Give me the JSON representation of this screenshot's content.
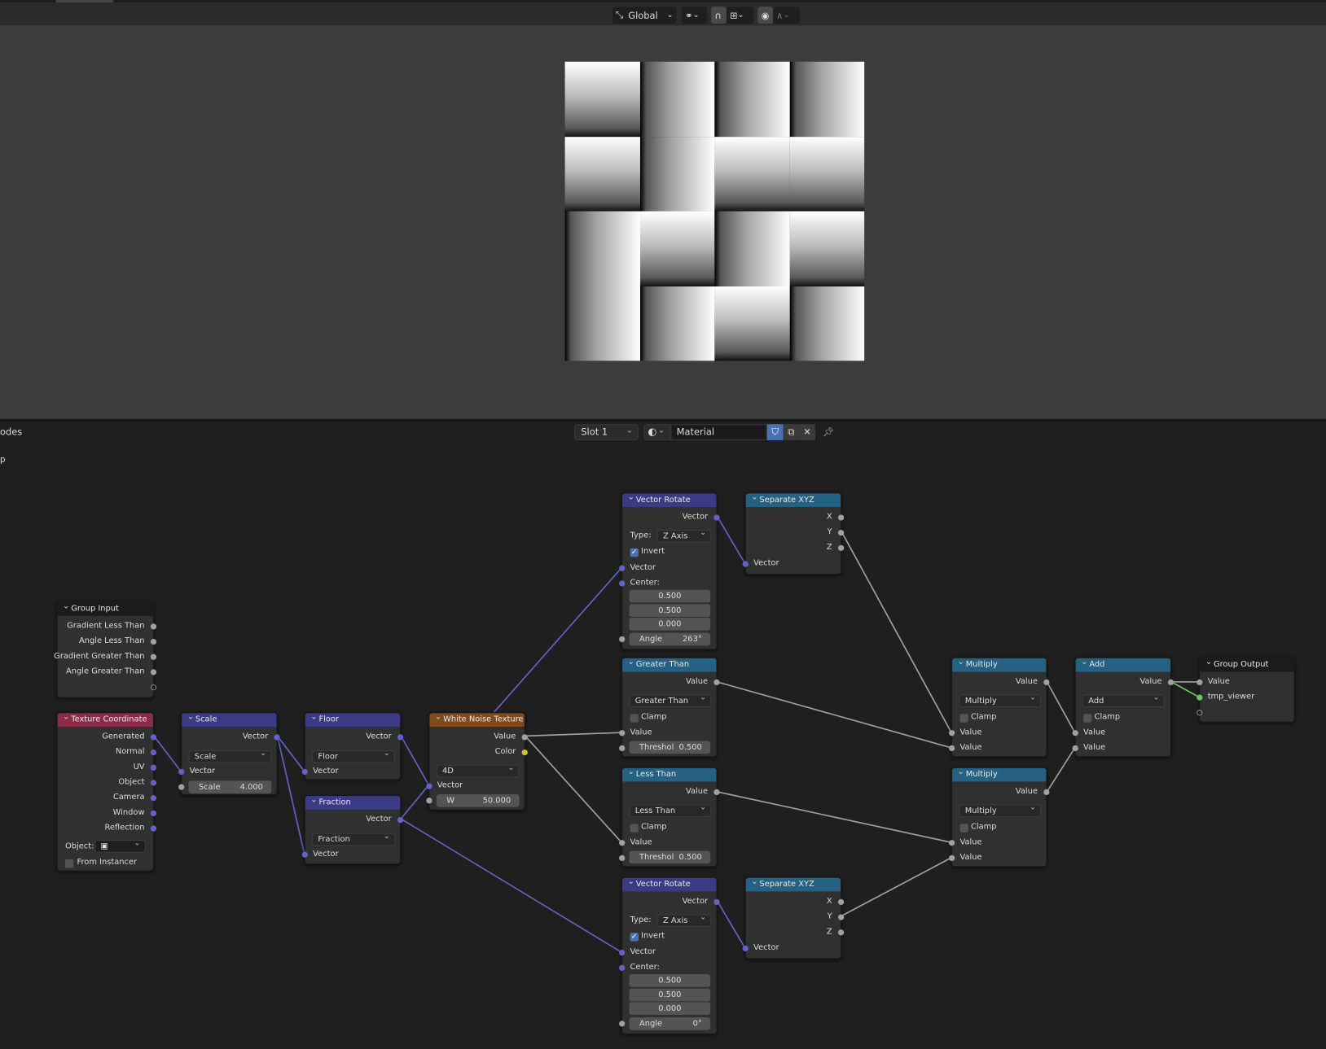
{
  "topbar": {
    "orientation": "Global",
    "icons": [
      "transform-orientation-icon",
      "pivot-icon",
      "snap-icon",
      "snap-increment-icon",
      "proportional-edit-icon",
      "falloff-icon"
    ]
  },
  "preview": {
    "tiles": [
      "V",
      "H",
      "H",
      "H",
      "V",
      "H",
      "V",
      "V",
      "H",
      "V",
      "H",
      "V",
      "H",
      "H",
      "V",
      "H"
    ]
  },
  "node_editor": {
    "header_title": "odes",
    "sub_label": "p",
    "slot": "Slot 1",
    "material_name": "Material"
  },
  "nodes": {
    "group_input": {
      "title": "Group Input",
      "outputs": [
        "Gradient Less Than",
        "Angle Less Than",
        "Gradient Greater Than",
        "Angle Greater Than"
      ]
    },
    "tex_coord": {
      "title": "Texture Coordinate",
      "outputs": [
        "Generated",
        "Normal",
        "UV",
        "Object",
        "Camera",
        "Window",
        "Reflection"
      ],
      "object_label": "Object:",
      "from_instancer": "From Instancer"
    },
    "scale": {
      "title": "Scale",
      "out": "Vector",
      "op": "Scale",
      "in": "Vector",
      "field_label": "Scale",
      "field_value": "4.000"
    },
    "floor": {
      "title": "Floor",
      "out": "Vector",
      "op": "Floor",
      "in": "Vector"
    },
    "fraction": {
      "title": "Fraction",
      "out": "Vector",
      "op": "Fraction",
      "in": "Vector"
    },
    "white_noise": {
      "title": "White Noise Texture",
      "out_value": "Value",
      "out_color": "Color",
      "dim": "4D",
      "in": "Vector",
      "w_label": "W",
      "w_value": "50.000"
    },
    "vrot1": {
      "title": "Vector Rotate",
      "out": "Vector",
      "type_label": "Type:",
      "type": "Z Axis",
      "invert": "Invert",
      "in": "Vector",
      "center": "Center:",
      "cx": "0.500",
      "cy": "0.500",
      "cz": "0.000",
      "angle_label": "Angle",
      "angle": "263°"
    },
    "vrot2": {
      "title": "Vector Rotate",
      "out": "Vector",
      "type_label": "Type:",
      "type": "Z Axis",
      "invert": "Invert",
      "in": "Vector",
      "center": "Center:",
      "cx": "0.500",
      "cy": "0.500",
      "cz": "0.000",
      "angle_label": "Angle",
      "angle": "0°"
    },
    "sep1": {
      "title": "Separate XYZ",
      "x": "X",
      "y": "Y",
      "z": "Z",
      "in": "Vector"
    },
    "sep2": {
      "title": "Separate XYZ",
      "x": "X",
      "y": "Y",
      "z": "Z",
      "in": "Vector"
    },
    "greater": {
      "title": "Greater Than",
      "out": "Value",
      "op": "Greater Than",
      "clamp": "Clamp",
      "in": "Value",
      "th_label": "Threshol",
      "th_value": "0.500"
    },
    "less": {
      "title": "Less Than",
      "out": "Value",
      "op": "Less Than",
      "clamp": "Clamp",
      "in": "Value",
      "th_label": "Threshol",
      "th_value": "0.500"
    },
    "mult1": {
      "title": "Multiply",
      "out": "Value",
      "op": "Multiply",
      "clamp": "Clamp",
      "in1": "Value",
      "in2": "Value"
    },
    "mult2": {
      "title": "Multiply",
      "out": "Value",
      "op": "Multiply",
      "clamp": "Clamp",
      "in1": "Value",
      "in2": "Value"
    },
    "add": {
      "title": "Add",
      "out": "Value",
      "op": "Add",
      "clamp": "Clamp",
      "in1": "Value",
      "in2": "Value"
    },
    "group_output": {
      "title": "Group Output",
      "inputs": [
        "Value",
        "tmp_viewer"
      ]
    }
  },
  "colors": {
    "vector_socket": "#6363c7",
    "float_socket": "#a1a1a1",
    "color_socket": "#c7c729",
    "viewer_socket": "#63c763",
    "accent": "#4772b3"
  }
}
